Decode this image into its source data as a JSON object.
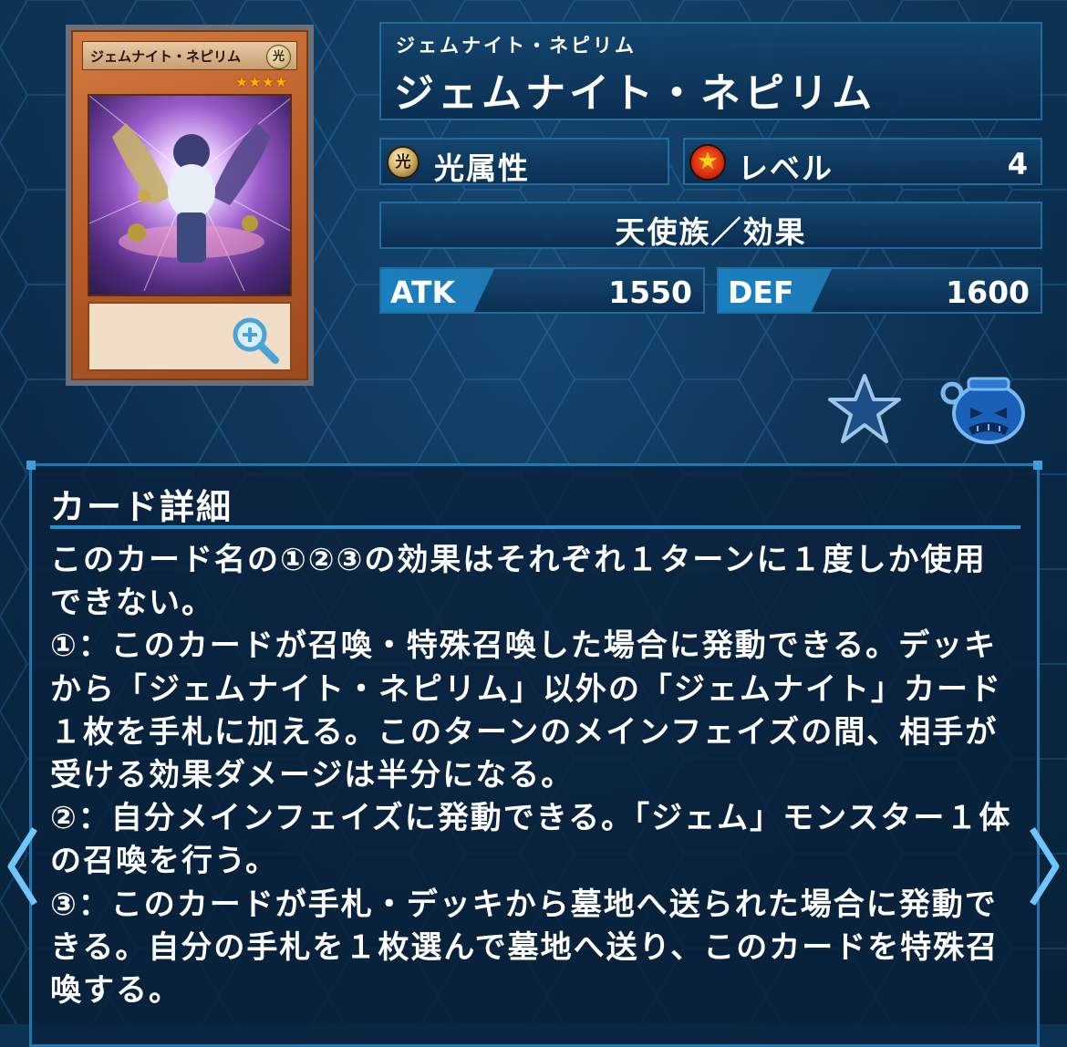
{
  "card": {
    "image_name": "ジェムナイト・ネピリム",
    "image_stars": "★★★★",
    "image_attr_glyph": "光"
  },
  "name": {
    "ruby": "ジェムナイト・ネピリム",
    "main": "ジェムナイト・ネピリム"
  },
  "attribute": {
    "label": "光属性",
    "icon": "light-attribute-icon",
    "glyph": "光"
  },
  "level": {
    "label": "レベル",
    "value": "4",
    "icon": "level-star-icon"
  },
  "type_line": "天使族／効果",
  "stats": {
    "atk_label": "ATK",
    "atk_value": "1550",
    "def_label": "DEF",
    "def_value": "1600"
  },
  "actions": {
    "favorite_icon": "star-icon",
    "deck_icon": "pot-icon"
  },
  "detail": {
    "title": "カード詳細",
    "text": "このカード名の①②③の効果はそれぞれ１ターンに１度しか使用できない。\n①：このカードが召喚・特殊召喚した場合に発動できる。デッキから「ジェムナイト・ネピリム」以外の「ジェムナイト」カード１枚を手札に加える。このターンのメインフェイズの間、相手が受ける効果ダメージは半分になる。\n②：自分メインフェイズに発動できる。「ジェム」モンスター１体の召喚を行う。\n③：このカードが手札・デッキから墓地へ送られた場合に発動できる。自分の手札を１枚選んで墓地へ送り、このカードを特殊召喚する。"
  },
  "colors": {
    "accent": "#1f77b0",
    "panel": "#0d3a63"
  }
}
